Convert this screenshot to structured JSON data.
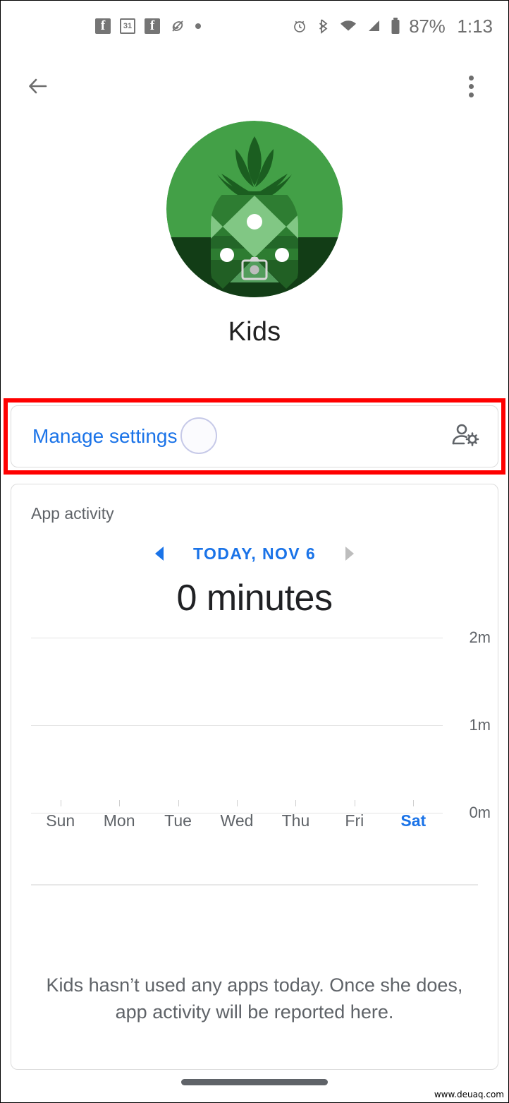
{
  "status_bar": {
    "notification_icons": [
      {
        "name": "facebook-icon",
        "glyph": "f"
      },
      {
        "name": "calendar-icon",
        "glyph": "31"
      },
      {
        "name": "facebook-icon-2",
        "glyph": "f"
      },
      {
        "name": "photos-sync-icon",
        "glyph": "⟳"
      },
      {
        "name": "more-notifications-dot",
        "glyph": "•"
      }
    ],
    "system_icons": [
      "alarm-icon",
      "bluetooth-icon",
      "wifi-icon",
      "cellular-signal-icon",
      "battery-icon"
    ],
    "battery_percent": "87%",
    "clock": "1:13"
  },
  "toolbar": {
    "back_label": "",
    "overflow_label": ""
  },
  "profile": {
    "name": "Kids",
    "avatar_alt": "pineapple-avatar",
    "avatar_colors": {
      "circle": "#43a047",
      "leaf_dark": "#1b5e20",
      "body_mid": "#2e7d32",
      "body_light": "#81c784",
      "body_shadow": "#123d16"
    }
  },
  "manage_settings": {
    "label": "Manage settings",
    "icon": "manage-accounts-icon",
    "highlight_color": "#ff0000",
    "accent_color": "#1a73e8"
  },
  "app_activity": {
    "title": "App activity",
    "date_label": "TODAY, NOV 6",
    "prev_arrow_enabled": true,
    "next_arrow_enabled": false,
    "total": "0 minutes",
    "empty_message": "Kids hasn’t used any apps today. Once she does, app activity will be reported here."
  },
  "chart_data": {
    "type": "bar",
    "title": "App activity",
    "subtitle": "0 minutes",
    "categories": [
      "Sun",
      "Mon",
      "Tue",
      "Wed",
      "Thu",
      "Fri",
      "Sat"
    ],
    "values": [
      0,
      0,
      0,
      0,
      0,
      0,
      0
    ],
    "highlighted_category": "Sat",
    "ytick_labels": [
      "0m",
      "1m",
      "2m"
    ],
    "ytick_values": [
      0,
      1,
      2
    ],
    "ylim": [
      0,
      2
    ],
    "xlabel": "",
    "ylabel": "",
    "grid": true,
    "legend": null,
    "unit": "minutes"
  },
  "system_nav": {
    "gesture_pill": "home-gesture-pill"
  },
  "watermark": {
    "text": "www.deuaq.com"
  }
}
